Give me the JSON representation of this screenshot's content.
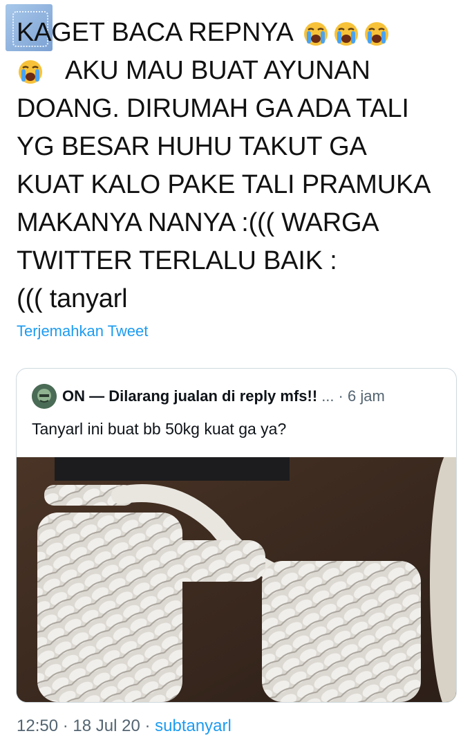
{
  "tweet": {
    "lines": [
      "KAGET BACA REPNYA",
      "AKU MAU BUAT AYUNAN",
      "DOANG. DIRUMAH GA ADA TALI",
      "YG BESAR HUHU TAKUT GA",
      "KUAT KALO PAKE TALI PRAMUKA",
      "MAKANYA NANYA :((( WARGA",
      "TWITTER TERLALU BAIK :",
      "((( tanyarl"
    ],
    "emoji_icon": "loudly-crying-face-icon",
    "translate_label": "Terjemahkan Tweet"
  },
  "quoted_tweet": {
    "author": "ON — Dilarang jualan di reply mfs!!",
    "ellipsis": "...",
    "time": "· 6 jam",
    "text": "Tanyarl ini buat bb 50kg kuat ga ya?",
    "image_icon": "coiled-white-rope-photo"
  },
  "footer": {
    "timestamp": "12:50 · 18 Jul 20 · ",
    "source": "subtanyarl"
  },
  "colors": {
    "link": "#1d9bf0",
    "text": "#0f1419",
    "muted": "#536471",
    "border": "#cfd9de"
  }
}
